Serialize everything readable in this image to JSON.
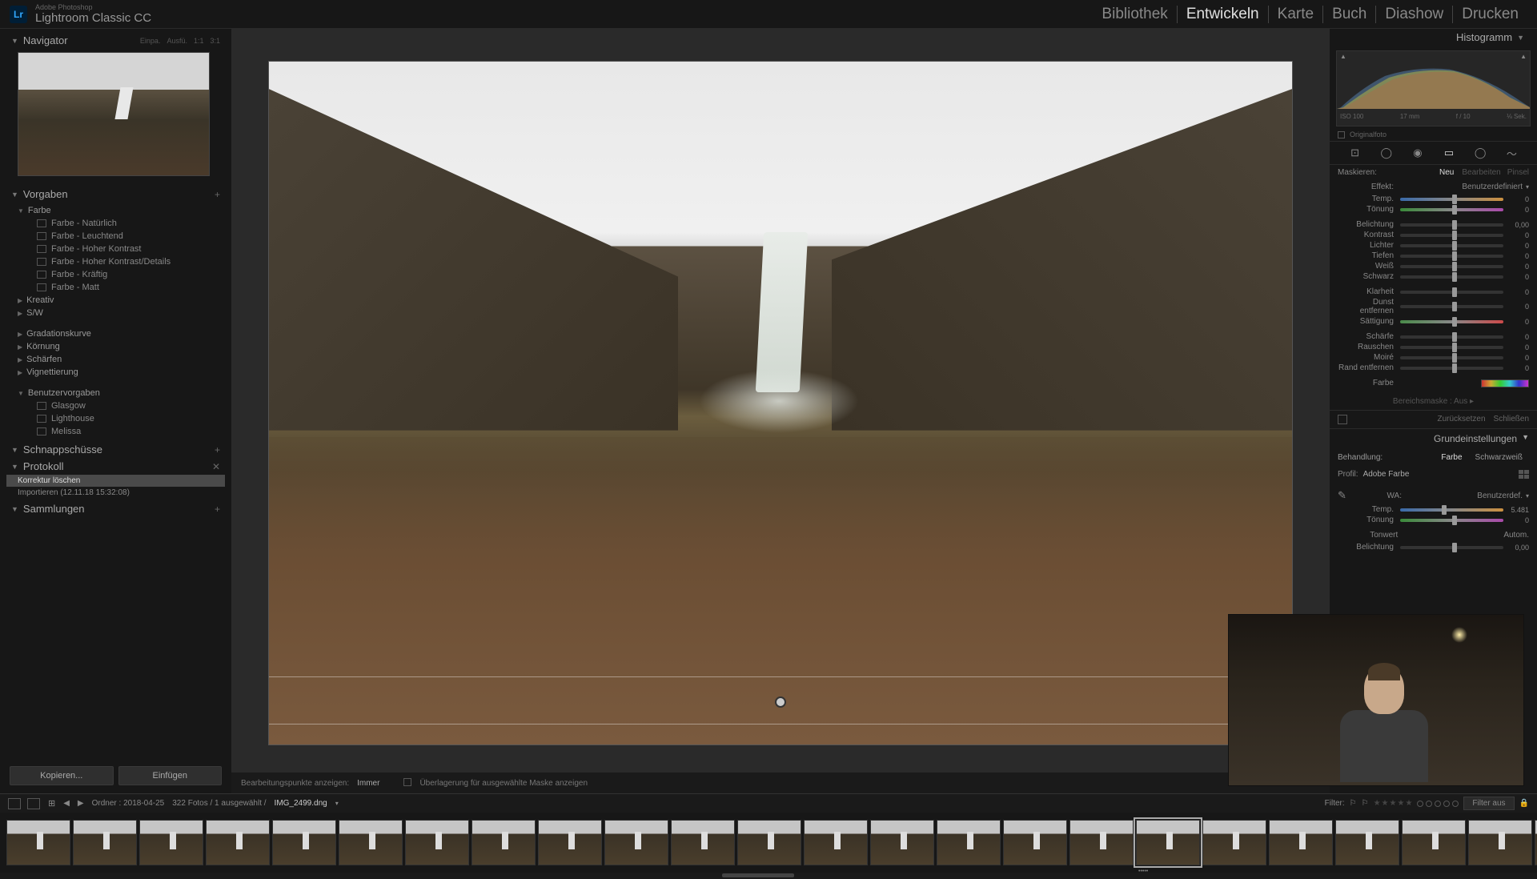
{
  "app": {
    "logo": "Lr",
    "title": "Adobe Photoshop",
    "subtitle": "Lightroom Classic CC"
  },
  "tabs": {
    "library": "Bibliothek",
    "develop": "Entwickeln",
    "map": "Karte",
    "book": "Buch",
    "slideshow": "Diashow",
    "print": "Drucken"
  },
  "navigator": {
    "title": "Navigator",
    "opts": [
      "Einpa.",
      "Ausfü.",
      "1:1",
      "3:1"
    ]
  },
  "presets": {
    "title": "Vorgaben",
    "groups": {
      "color": "Farbe",
      "items": [
        "Farbe - Natürlich",
        "Farbe - Leuchtend",
        "Farbe - Hoher Kontrast",
        "Farbe - Hoher Kontrast/Details",
        "Farbe - Kräftig",
        "Farbe - Matt"
      ],
      "creative": "Kreativ",
      "bw": "S/W",
      "curve": "Gradationskurve",
      "grain": "Körnung",
      "sharpen": "Schärfen",
      "vignette": "Vignettierung",
      "user": "Benutzervorgaben",
      "userItems": [
        "Glasgow",
        "Lighthouse",
        "Melissa"
      ]
    }
  },
  "snapshots": {
    "title": "Schnappschüsse"
  },
  "history": {
    "title": "Protokoll",
    "items": [
      "Korrektur löschen",
      "Importieren (12.11.18 15:32:08)"
    ]
  },
  "collections": {
    "title": "Sammlungen"
  },
  "leftButtons": {
    "copy": "Kopieren...",
    "paste": "Einfügen"
  },
  "centerToolbar": {
    "editPoints": "Bearbeitungspunkte anzeigen:",
    "mode": "Immer",
    "overlay": "Überlagerung für ausgewählte Maske anzeigen"
  },
  "infoBar": {
    "path": "Ordner : 2018-04-25",
    "count": "322 Fotos / 1 ausgewählt /",
    "file": "IMG_2499.dng",
    "filter": "Filter:",
    "filterOff": "Filter aus"
  },
  "histogram": {
    "title": "Histogramm",
    "iso": "ISO 100",
    "focal": "17 mm",
    "aperture": "f / 10",
    "shutter": "⅛ Sek.",
    "original": "Originalfoto"
  },
  "mask": {
    "label": "Maskieren:",
    "new": "Neu",
    "edit": "Bearbeiten",
    "pinsel": "Pinsel",
    "effect": "Effekt:",
    "effectVal": "Benutzerdefiniert",
    "sliders": {
      "temp": {
        "label": "Temp.",
        "val": "0"
      },
      "tint": {
        "label": "Tönung",
        "val": "0"
      },
      "exposure": {
        "label": "Belichtung",
        "val": "0,00"
      },
      "contrast": {
        "label": "Kontrast",
        "val": "0"
      },
      "highlights": {
        "label": "Lichter",
        "val": "0"
      },
      "shadows": {
        "label": "Tiefen",
        "val": "0"
      },
      "whites": {
        "label": "Weiß",
        "val": "0"
      },
      "blacks": {
        "label": "Schwarz",
        "val": "0"
      },
      "clarity": {
        "label": "Klarheit",
        "val": "0"
      },
      "dehaze": {
        "label": "Dunst entfernen",
        "val": "0"
      },
      "saturation": {
        "label": "Sättigung",
        "val": "0"
      },
      "sharpness": {
        "label": "Schärfe",
        "val": "0"
      },
      "noise": {
        "label": "Rauschen",
        "val": "0"
      },
      "moire": {
        "label": "Moiré",
        "val": "0"
      },
      "defringe": {
        "label": "Rand entfernen",
        "val": "0"
      }
    },
    "color": "Farbe",
    "rangeMask": "Bereichsmaske : Aus",
    "reset": "Zurücksetzen",
    "close": "Schließen"
  },
  "basic": {
    "title": "Grundeinstellungen",
    "treatment": "Behandlung:",
    "color": "Farbe",
    "bw": "Schwarzweiß",
    "profile": "Profil:",
    "profileVal": "Adobe Farbe",
    "wb": "WA:",
    "wbVal": "Benutzerdef.",
    "temp": {
      "label": "Temp.",
      "val": "5.481"
    },
    "tint": {
      "label": "Tönung",
      "val": "0"
    },
    "tone": "Tonwert",
    "auto": "Autom.",
    "exposure": {
      "label": "Belichtung",
      "val": "0,00"
    }
  },
  "thumbCount": 24,
  "thumbSelected": 17
}
